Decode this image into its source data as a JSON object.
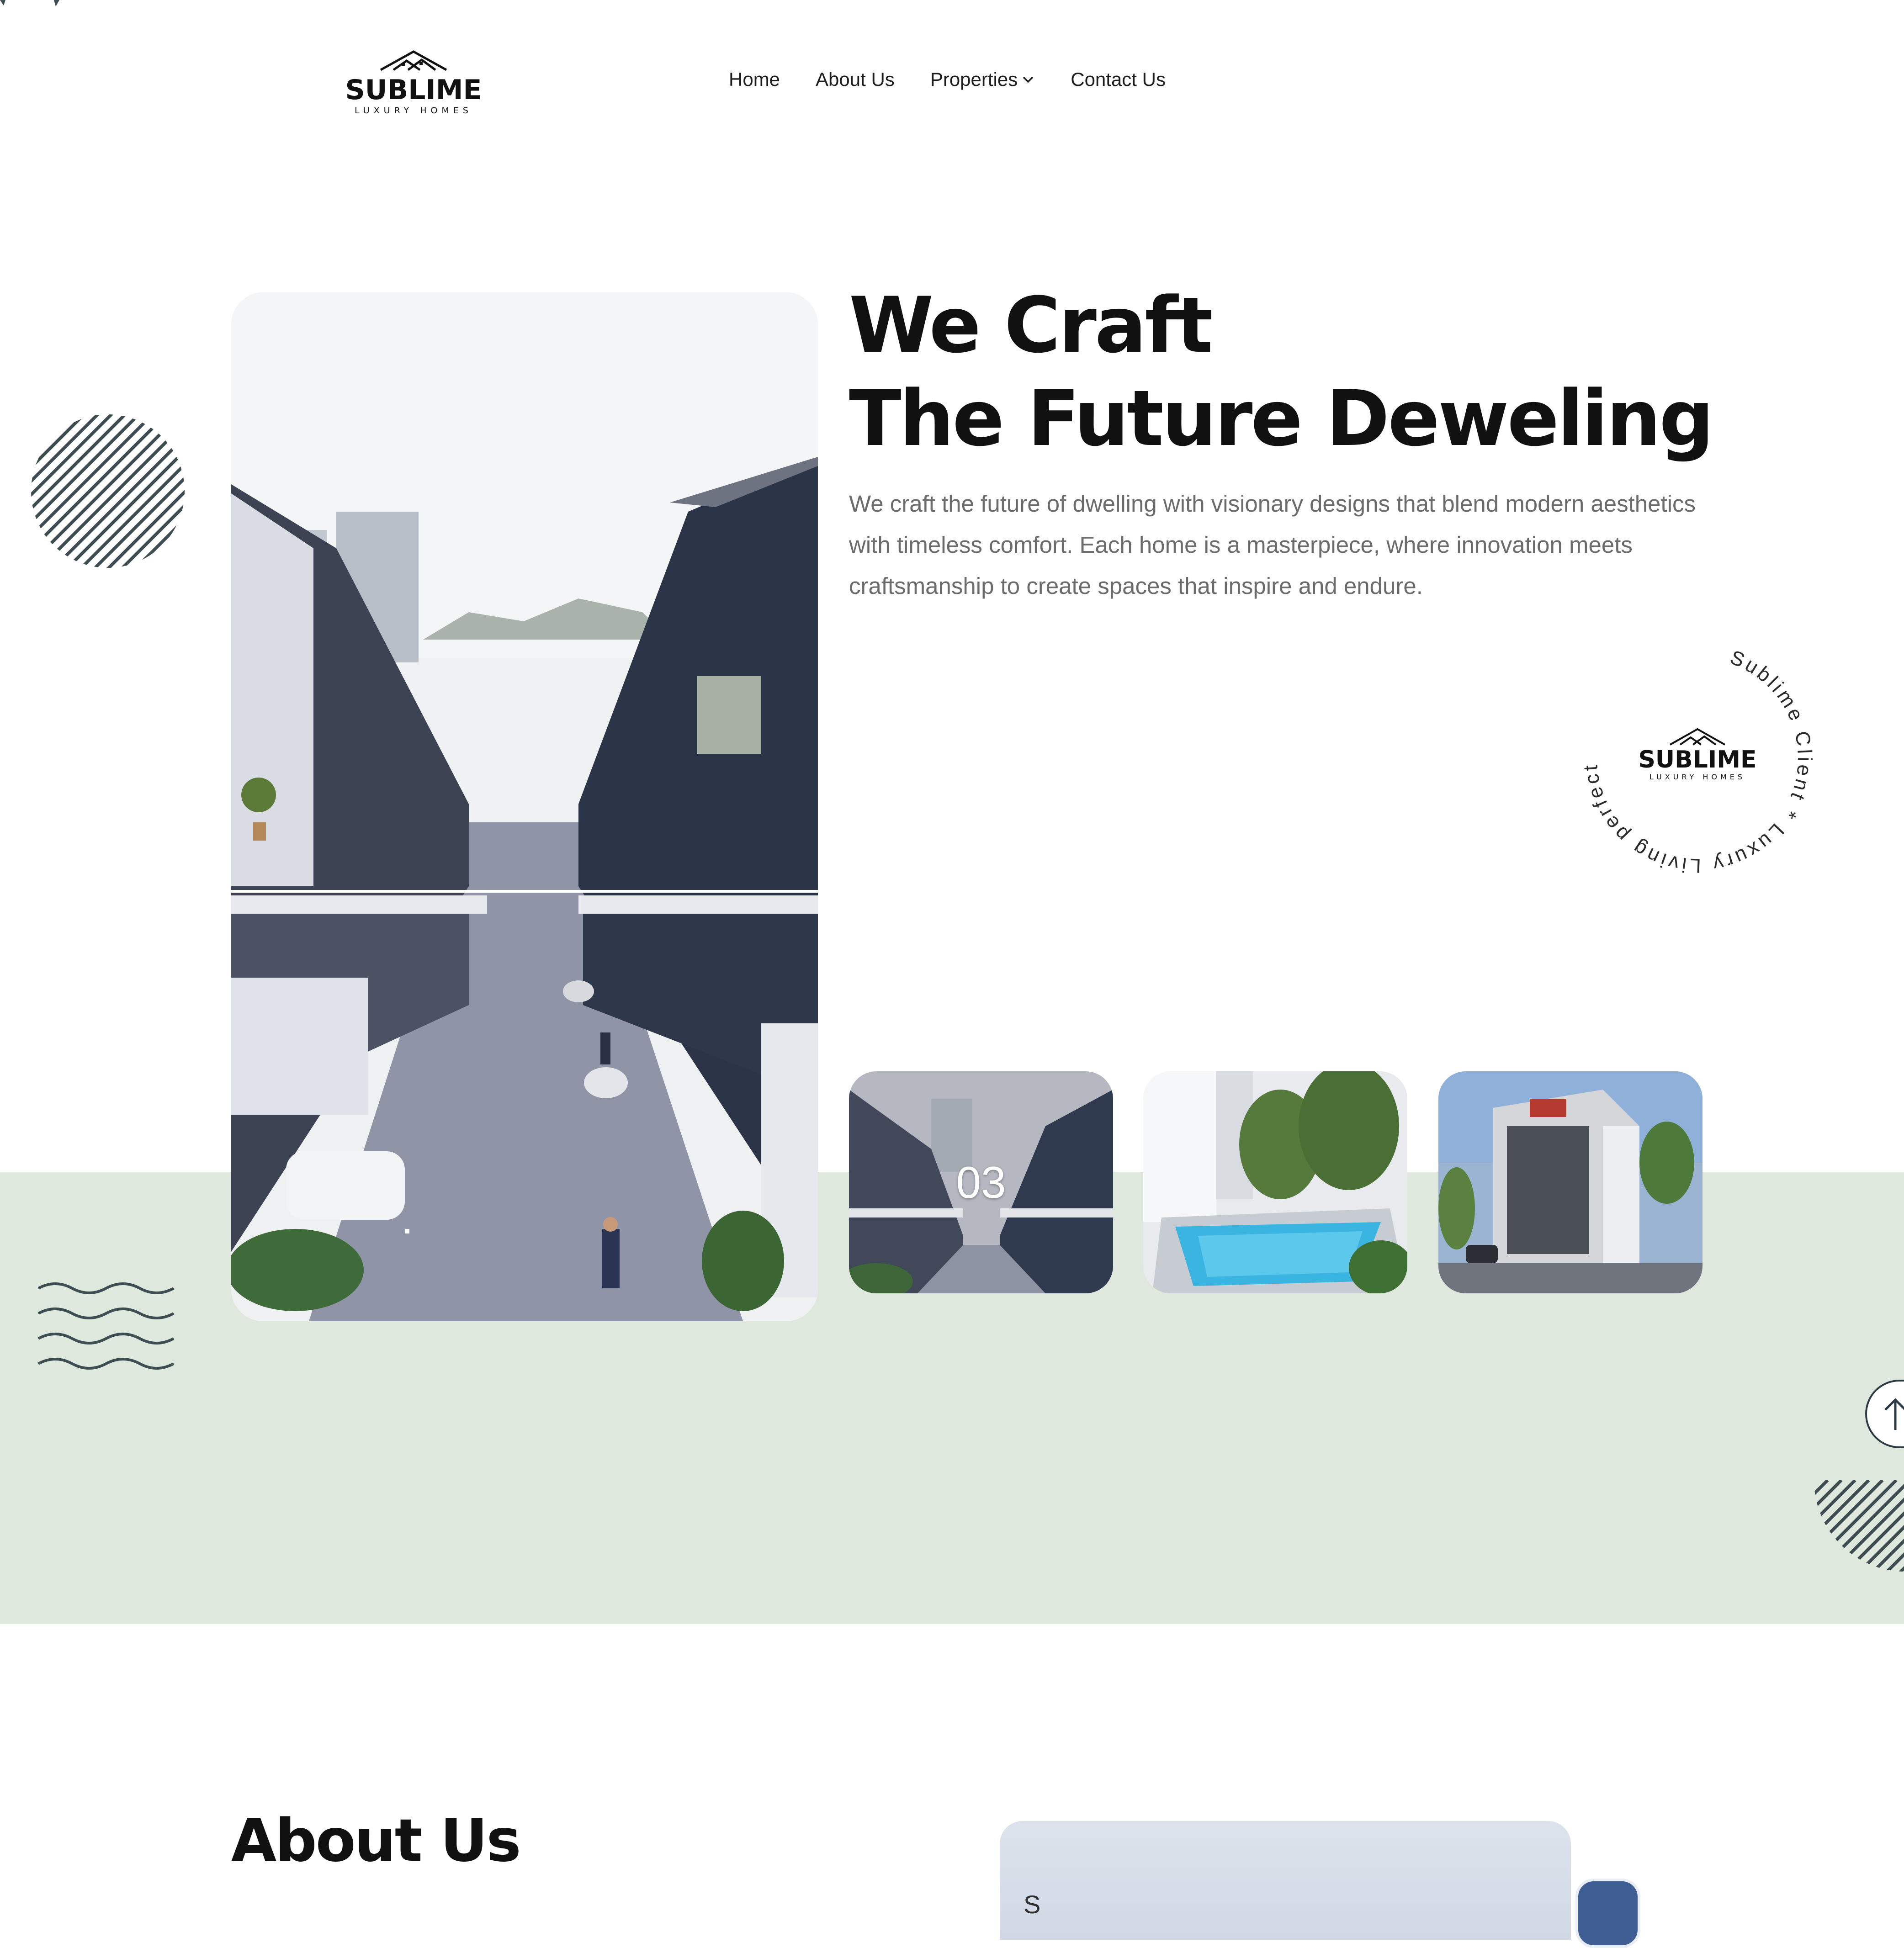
{
  "brand": {
    "name": "SUBLIME",
    "tagline": "LUXURY HOMES"
  },
  "nav": {
    "items": [
      {
        "label": "Home"
      },
      {
        "label": "About Us"
      },
      {
        "label": "Properties"
      },
      {
        "label": "Contact Us"
      }
    ]
  },
  "hero": {
    "headline_line1": "We Craft",
    "headline_line2": "The Future Deweling",
    "description": "We craft the future of dwelling with visionary designs that blend modern aesthetics with timeless comfort. Each home is a masterpiece, where innovation meets craftsmanship to create spaces that inspire and endure.",
    "badge_circle_text": "Sublime Client * Luxury Living perfected",
    "badge_brand": "SUBLIME",
    "badge_tagline": "LUXURY HOMES"
  },
  "thumbnails": [
    {
      "label": "03"
    },
    {
      "label": ""
    },
    {
      "label": ""
    }
  ],
  "about": {
    "title": "About Us",
    "image_text": "S"
  },
  "colors": {
    "band": "#dee8dd",
    "text_dark": "#111111",
    "text_muted": "#6b6b6b",
    "accent_navy": "#2f3b52"
  },
  "icons": {
    "properties_dropdown": "chevron-down-icon",
    "scroll_top": "arrow-up-icon"
  }
}
